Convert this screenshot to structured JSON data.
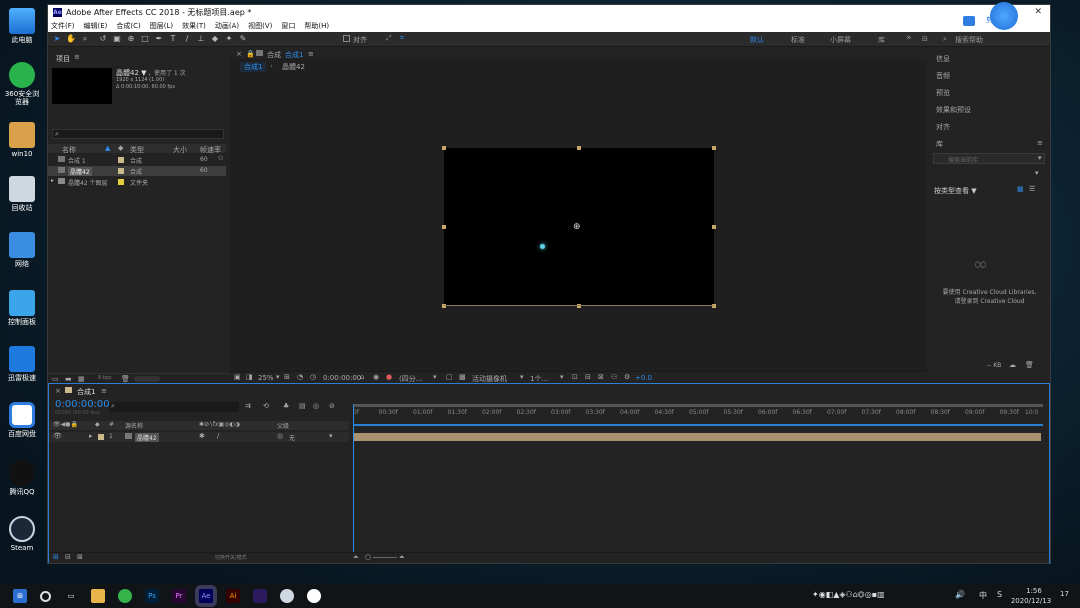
{
  "desktop": {
    "icons": [
      {
        "label": "此电脑"
      },
      {
        "label": "360安全浏览器"
      },
      {
        "label": "win10"
      },
      {
        "label": "回收站"
      },
      {
        "label": "网络"
      },
      {
        "label": "控制面板"
      },
      {
        "label": "迅雷极速"
      },
      {
        "label": "百度网盘"
      },
      {
        "label": "腾讯QQ"
      },
      {
        "label": "Steam"
      }
    ],
    "floating_badge": "剪"
  },
  "window": {
    "title": "Adobe After Effects CC 2018 - 无标题项目.aep *",
    "app_icon": "Ae",
    "close": "✕",
    "menu": [
      "文件(F)",
      "编辑(E)",
      "合成(C)",
      "图层(L)",
      "效果(T)",
      "动画(A)",
      "视图(V)",
      "窗口",
      "帮助(H)"
    ]
  },
  "toolbar": {
    "snap_label": "对齐",
    "workspaces": [
      "默认",
      "标准",
      "小屏幕",
      "库"
    ],
    "active_workspace": "默认",
    "more": "»",
    "search_placeholder": "搜索帮助"
  },
  "project_panel": {
    "title": "项目",
    "selected_name": "晶體42 ▼",
    "used_count": "，使用了 1 次",
    "dimensions": "1920 x 1124 (1.00)",
    "duration": "Δ 0:00:10:00, 60.00 fps",
    "search_icon": "⌕",
    "columns": [
      "名称",
      "类型",
      "大小",
      "帧速率"
    ],
    "rows": [
      {
        "name": "合成 1",
        "type": "合成",
        "size": "",
        "fps": "60",
        "color": "#c9b98c"
      },
      {
        "name": "晶體42",
        "type": "合成",
        "size": "",
        "fps": "60",
        "color": "#c9b98c",
        "selected": true
      },
      {
        "name": "晶體42 个图层",
        "type": "文件夹",
        "size": "",
        "fps": "",
        "color": "#e2cf3a"
      }
    ],
    "bpc": "8 bpc"
  },
  "comp_panel": {
    "tab_title": "合成",
    "tab_name": "合成1",
    "breadcrumbs": [
      "合成1",
      "晶體42"
    ],
    "zoom": "25%",
    "timecode": "0:00:00:00",
    "resolution": "(四分...",
    "camera": "活动摄像机",
    "views": "1个...",
    "exposure": "+0.0"
  },
  "right_panel": {
    "sections": [
      "信息",
      "音频",
      "预览",
      "效果和预设",
      "对齐"
    ],
    "library_title": "库",
    "library_search_placeholder": "搜索当前库",
    "library_view": "按类型查看 ▼",
    "library_message_1": "要使用 Creative Cloud Libraries,",
    "library_message_2": "请登录到 Creative Cloud",
    "library_size": "-- KB"
  },
  "timeline": {
    "tab_name": "合成1",
    "timecode": "0:00:00:00",
    "timecode_sub": "00000 (60.00 fps)",
    "columns": [
      "#",
      "源名称",
      "父级"
    ],
    "layer": {
      "index": "1",
      "name": "晶體42",
      "parent": "无"
    },
    "footer": "切换开关/模式",
    "ticks": [
      "0f",
      "00:30f",
      "01:00f",
      "01:30f",
      "02:00f",
      "02:30f",
      "03:00f",
      "03:30f",
      "04:00f",
      "04:30f",
      "05:00f",
      "05:30f",
      "06:00f",
      "06:30f",
      "07:00f",
      "07:30f",
      "08:00f",
      "08:30f",
      "09:00f",
      "09:30f",
      "10:0"
    ]
  },
  "taskbar": {
    "apps": [
      "Ps",
      "Pr",
      "Ae",
      "Ai"
    ],
    "ime": "中",
    "ime2": "S",
    "time": "1:56",
    "date": "2020/12/13",
    "notifications": "17"
  },
  "colors": {
    "accent": "#2d8ceb",
    "comp_bg": "#000000",
    "layer_bar": "#a89270",
    "timeline_accent": "#2a7fd4"
  }
}
